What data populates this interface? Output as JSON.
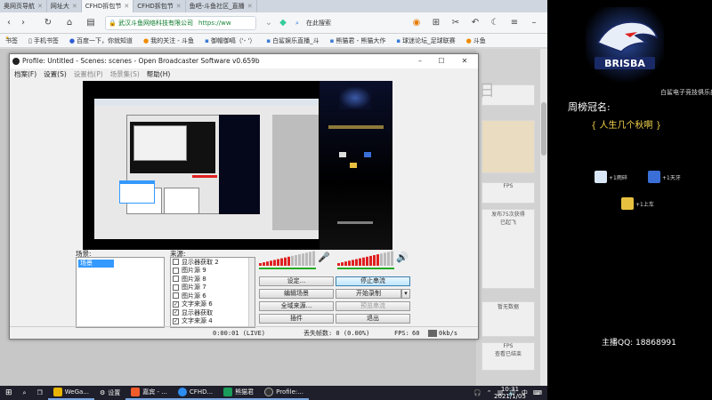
{
  "browser": {
    "tabs": [
      {
        "label": "奥网页导航",
        "active": false
      },
      {
        "label": "网址大",
        "active": false
      },
      {
        "label": "CFHD拆包节",
        "active": true
      },
      {
        "label": "CFHD拆包节",
        "active": false
      },
      {
        "label": "鱼吧-斗鱼社区_直播",
        "active": false
      }
    ],
    "site_owner": "武汉斗鱼网络科技有限公司",
    "url": "https://ww",
    "search_placeholder": "在此搜索",
    "bookmarks": [
      "书签",
      "手机书签",
      "百度一下，你就知道",
      "我的关注 - 斗鱼",
      "御帽御嗝（'- '）",
      "白鲨娱乐直播_斗",
      "熊猫君 - 熊猫大作",
      "球迷论坛_足球联赛",
      "斗鱼"
    ],
    "date_partial": "日",
    "sidebar_cards": [
      "FPS",
      "发布75次获得",
      "已起飞",
      "暂无数据",
      "FPS",
      "查看已结束"
    ]
  },
  "obs": {
    "title": "Profile: Untitled - Scenes: scenes - Open Broadcaster Software v0.659b",
    "menu": [
      {
        "label": "档案(F)",
        "dim": false
      },
      {
        "label": "设置(S)",
        "dim": false
      },
      {
        "label": "设置档(P)",
        "dim": true
      },
      {
        "label": "场景集(S)",
        "dim": true
      },
      {
        "label": "帮助(H)",
        "dim": false
      }
    ],
    "scenes_label": "场景:",
    "scenes": [
      "场景"
    ],
    "sources_label": "来源:",
    "sources": [
      {
        "label": "显示器获取 2",
        "checked": false
      },
      {
        "label": "图片源 9",
        "checked": false
      },
      {
        "label": "图片源 8",
        "checked": false
      },
      {
        "label": "图片源 7",
        "checked": false
      },
      {
        "label": "图片源 6",
        "checked": false
      },
      {
        "label": "文字来源 6",
        "checked": true
      },
      {
        "label": "显示器获取",
        "checked": true
      },
      {
        "label": "文字来源 4",
        "checked": true
      }
    ],
    "buttons": {
      "settings": "设定...",
      "stop_stream": "停止串流",
      "edit_scene": "编辑场景",
      "start_record": "开始录制",
      "global_sources": "全域来源...",
      "preview_stream": "预览串流",
      "plugins": "插件",
      "exit": "退出"
    },
    "status": {
      "time": "0:00:01 (LIVE)",
      "dropped": "丢失帧数: 0 (0.00%)",
      "fps_label": "FPS:",
      "fps": "60",
      "bitrate": "0kb/s"
    },
    "mic_level": 0.55,
    "desktop_level": 0.7
  },
  "panel": {
    "logo_text": "BRISBA",
    "logo_caption": "白鲨电子竞技俱乐部",
    "week_title": "周榜冠名:",
    "week_name": "{ 人生几个秋啊 }",
    "gifts": [
      {
        "label": "+1雨碎",
        "color": "#d9e6f5"
      },
      {
        "label": "+1天牙",
        "color": "#3a6fd8"
      },
      {
        "label": "+1上车",
        "color": "#e8c040"
      }
    ],
    "qq_label": "主播QQ:",
    "qq_number": "18868991"
  },
  "taskbar": {
    "items": [
      {
        "label": "",
        "icon": "search-icon",
        "open": false
      },
      {
        "label": "",
        "icon": "task-view-icon",
        "open": false
      },
      {
        "label": "WeGa...",
        "icon": "wegame-icon",
        "open": true
      },
      {
        "label": "设置",
        "icon": "gear-icon",
        "open": false
      },
      {
        "label": "嘉宾 - ...",
        "icon": "chat-icon",
        "open": true
      },
      {
        "label": "CFHD...",
        "icon": "browser-icon",
        "open": true
      },
      {
        "label": "熊猫君",
        "icon": "panda-icon",
        "open": true
      },
      {
        "label": "Profile:...",
        "icon": "obs-icon",
        "open": true
      }
    ],
    "tray_lang": "中",
    "time": "10:31",
    "date": "2021/1/05"
  },
  "colors": {
    "accent_blue": "#3399ff",
    "live_red": "#e02020",
    "level_green": "#22aa22",
    "gold": "#f3d34a"
  }
}
